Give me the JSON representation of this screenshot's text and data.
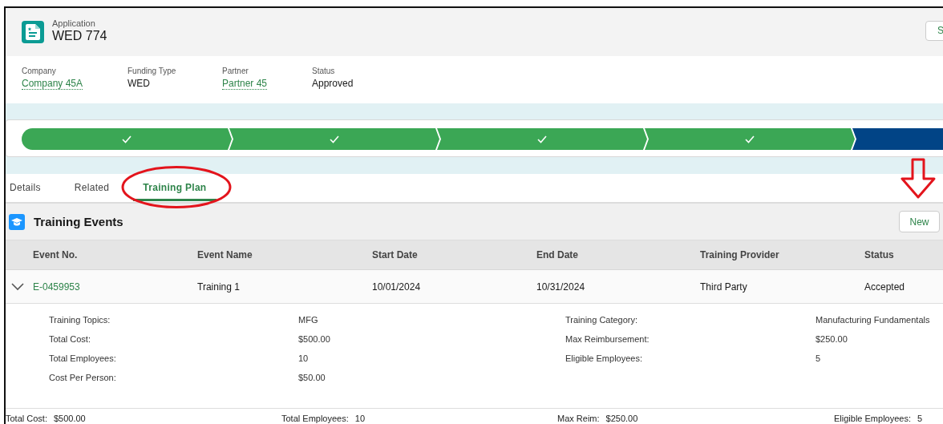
{
  "record": {
    "object_label": "Application",
    "title": "WED 774",
    "action_button": "S"
  },
  "highlights": [
    {
      "label": "Company",
      "value": "Company 45A",
      "kind": "link"
    },
    {
      "label": "Funding Type",
      "value": "WED",
      "kind": "text"
    },
    {
      "label": "Partner",
      "value": "Partner 45",
      "kind": "link"
    },
    {
      "label": "Status",
      "value": "Approved",
      "kind": "text"
    }
  ],
  "path": [
    {
      "completed": true,
      "current": false
    },
    {
      "completed": true,
      "current": false
    },
    {
      "completed": true,
      "current": false
    },
    {
      "completed": true,
      "current": false
    },
    {
      "completed": false,
      "current": true
    }
  ],
  "tabs": [
    {
      "label": "Details",
      "selected": false
    },
    {
      "label": "Related",
      "selected": false
    },
    {
      "label": "Training Plan",
      "selected": true
    }
  ],
  "card": {
    "title": "Training Events",
    "new_button": "New"
  },
  "table": {
    "columns": [
      "Event No.",
      "Event Name",
      "Start Date",
      "End Date",
      "Training Provider",
      "Status"
    ],
    "rows": [
      {
        "expanded": true,
        "cells": [
          "E-0459953",
          "Training 1",
          "10/01/2024",
          "10/31/2024",
          "Third Party",
          "Accepted"
        ],
        "details_left": [
          {
            "label": "Training Topics:",
            "value": "MFG"
          },
          {
            "label": "Total Cost:",
            "value": "$500.00"
          },
          {
            "label": "Total Employees:",
            "value": "10"
          },
          {
            "label": "Cost Per Person:",
            "value": "$50.00"
          }
        ],
        "details_right": [
          {
            "label": "Training Category:",
            "value": "Manufacturing Fundamentals"
          },
          {
            "label": "Max Reimbursement:",
            "value": "$250.00"
          },
          {
            "label": "Eligible Employees:",
            "value": "5"
          }
        ]
      }
    ]
  },
  "totals": [
    {
      "label": "Total Cost:",
      "value": "$500.00"
    },
    {
      "label": "Total Employees:",
      "value": "10"
    },
    {
      "label": "Max Reim:",
      "value": "$250.00"
    },
    {
      "label": "Eligible Employees:",
      "value": "5"
    }
  ],
  "annotations": {
    "ellipse_around_selected_tab": true,
    "arrow_to_new_button": true
  }
}
